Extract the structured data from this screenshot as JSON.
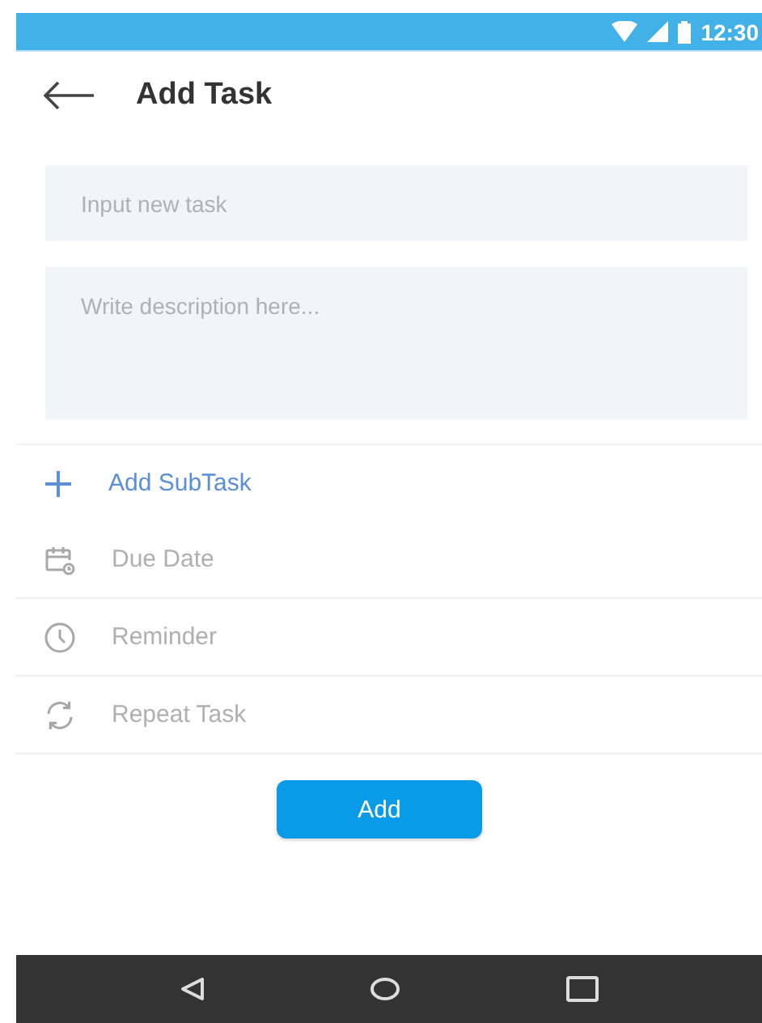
{
  "status_bar": {
    "time": "12:30"
  },
  "header": {
    "title": "Add Task"
  },
  "task_field": {
    "placeholder": "Input new task"
  },
  "description_field": {
    "placeholder": "Write description here..."
  },
  "options": [
    {
      "kind": "subtask",
      "label": "Add SubTask"
    },
    {
      "kind": "date",
      "label": "Due Date"
    },
    {
      "kind": "reminder",
      "label": "Reminder"
    },
    {
      "kind": "repeat",
      "label": "Repeat Task"
    }
  ],
  "add_button": {
    "label": "Add"
  }
}
